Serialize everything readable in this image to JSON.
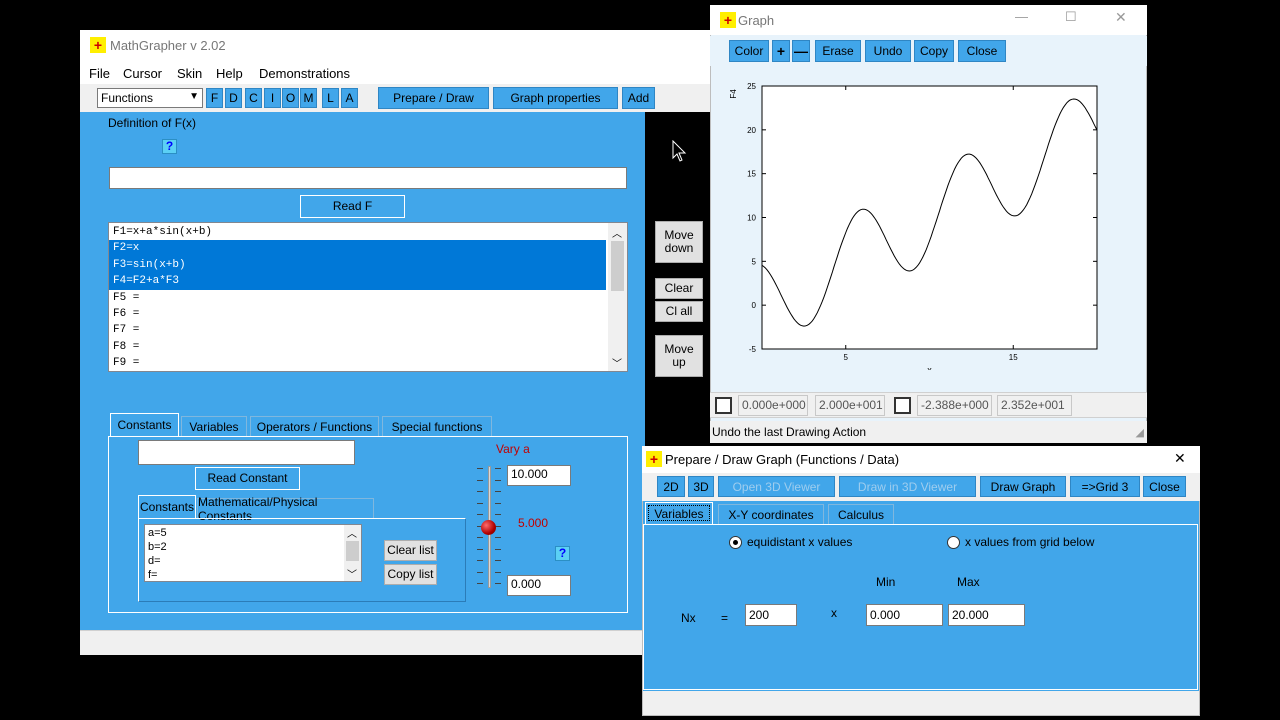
{
  "main": {
    "title": "MathGrapher v 2.02",
    "menu": [
      "File",
      "Cursor",
      "Skin",
      "Help",
      "Demonstrations"
    ],
    "mode_select": "Functions",
    "letter_buttons": [
      "F",
      "D",
      "C",
      "I",
      "O",
      "M",
      "L",
      "A"
    ],
    "toolbar": {
      "prepare": "Prepare / Draw",
      "graph_props": "Graph properties",
      "add": "Add"
    },
    "def_label": "Definition of F(x)",
    "help": "?",
    "read_f": "Read F",
    "functions": [
      "F1=x+a*sin(x+b)",
      "F2=x",
      "F3=sin(x+b)",
      "F4=F2+a*F3",
      "F5 =",
      "F6 =",
      "F7 =",
      "F8 =",
      "F9 ="
    ],
    "side_buttons": {
      "move_down": "Move down",
      "clear": "Clear",
      "cl_all": "Cl all",
      "move_up": "Move up"
    },
    "tabs": [
      "Constants",
      "Variables",
      "Operators / Functions",
      "Special functions"
    ],
    "read_constant": "Read Constant",
    "subtabs": [
      "Constants",
      "Mathematical/Physical Constants"
    ],
    "constants": [
      "a=5",
      "b=2",
      "d=",
      "f="
    ],
    "clear_list": "Clear list",
    "copy_list": "Copy list",
    "vary_label": "Vary a",
    "vary_max": "10.000",
    "vary_value": "5.000",
    "vary_min": "0.000"
  },
  "graph": {
    "title": "Graph",
    "buttons": [
      "Color",
      "+",
      "—",
      "Erase",
      "Undo",
      "Copy",
      "Close"
    ],
    "status": "Undo the last Drawing Action",
    "xmin": "0.000e+000",
    "xmax": "2.000e+001",
    "ymin": "-2.388e+000",
    "ymax": "2.352e+001"
  },
  "prep": {
    "title": "Prepare / Draw Graph (Functions / Data)",
    "buttons": {
      "b2d": "2D",
      "b3d": "3D",
      "open3d": "Open 3D Viewer",
      "draw3d": "Draw in 3D Viewer",
      "draw": "Draw Graph",
      "grid": "=>Grid 3",
      "close": "Close"
    },
    "tabs": [
      "Variables",
      "X-Y coordinates",
      "Calculus"
    ],
    "radio1": "equidistant x values",
    "radio2": "x values from grid below",
    "min_label": "Min",
    "max_label": "Max",
    "nx_label": "Nx",
    "eq": "=",
    "times": "x",
    "nx": "200",
    "min": "0.000",
    "max": "20.000"
  },
  "chart_data": {
    "type": "line",
    "title": "",
    "xlabel": "x",
    "ylabel": "F4",
    "xlim": [
      0,
      20
    ],
    "ylim": [
      -5,
      25
    ],
    "xticks": [
      5,
      15
    ],
    "yticks": [
      -5,
      0,
      5,
      10,
      15,
      20,
      25
    ],
    "series": [
      {
        "expression": "x + 5*sin(x+2)",
        "color": "#000000"
      }
    ]
  },
  "colors": {
    "panel_blue": "#41a6ea",
    "selection": "#0078d7",
    "plot_bg": "#e8f3fb"
  }
}
